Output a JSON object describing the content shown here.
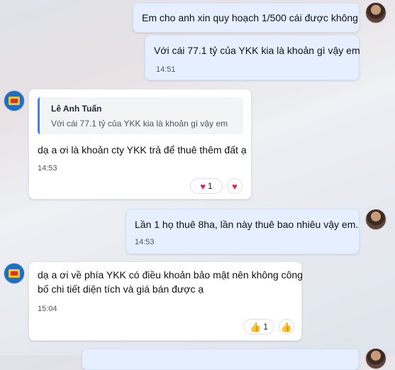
{
  "messages": [
    {
      "text": "Em cho anh xin quy hoạch 1/500 cái được không",
      "time": ""
    },
    {
      "text": "Với cái 77.1 tỷ của YKK kia là khoản gì vậy em",
      "time": "14:51"
    },
    {
      "quote_name": "Lê Anh Tuấn",
      "quote_text": "Với cái 77.1 tỷ của YKK kia là khoản gì vậy em",
      "text": "dạ a ơi là khoản cty YKK trả để thuê thêm đất ạ",
      "time": "14:53",
      "reaction_count": "1"
    },
    {
      "text": "Lần 1 họ thuê 8ha, lần này thuê bao nhiêu vậy em.",
      "time": "14:53"
    },
    {
      "text_line1": "dạ a ơi về phía YKK có điều khoản bảo mật nên không công",
      "text_line2": "bố chi tiết diện tích và giá bán được ạ",
      "time": "15:04",
      "reaction_count": "1"
    }
  ],
  "icons": {
    "heart": "♥",
    "thumb": "👍"
  },
  "colors": {
    "outgoing_bubble": "#e5efff",
    "incoming_bubble": "#ffffff",
    "quote_accent": "#3b82f6",
    "heart": "#e0245e",
    "thumb": "#f2b418"
  }
}
